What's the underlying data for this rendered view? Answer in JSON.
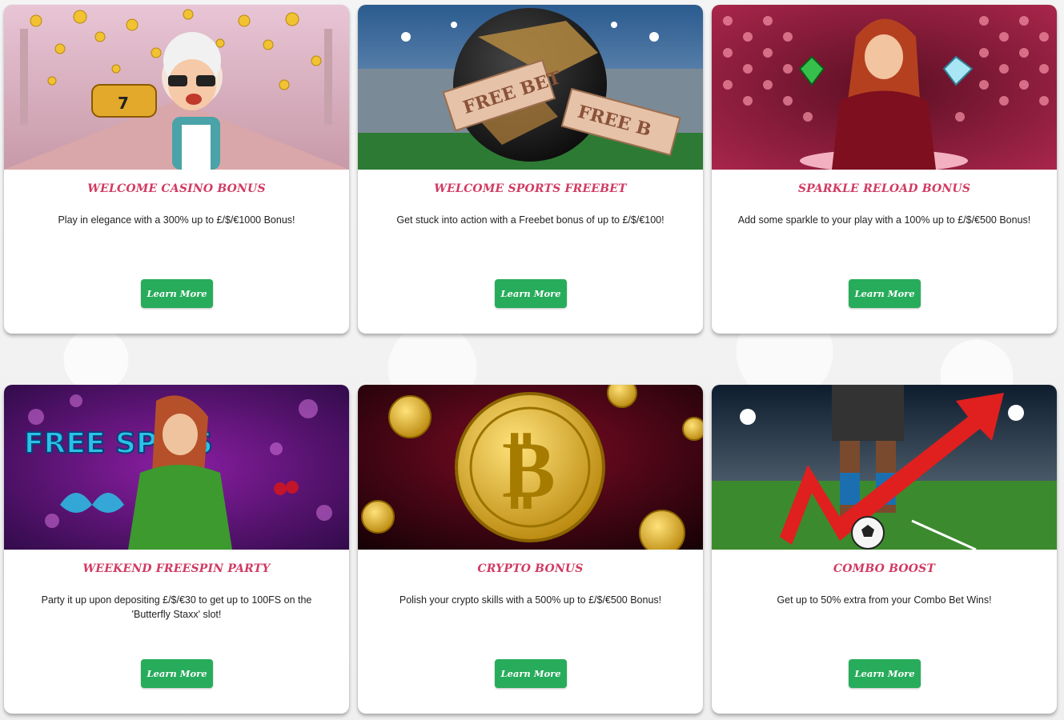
{
  "promotions": [
    {
      "title": "WELCOME CASINO BONUS",
      "description": "Play in elegance with a 300% up to £/$/€1000 Bonus!",
      "button_label": "Learn More",
      "banner_icon": "granny-slot-illustration",
      "banner_colors": [
        "#e7c6d6",
        "#f3dfe8",
        "#f2c12e"
      ]
    },
    {
      "title": "WELCOME SPORTS FREEBET",
      "description": "Get stuck into action with a Freebet bonus of up to £/$/€100!",
      "button_label": "Learn More",
      "banner_icon": "football-freebet-illustration",
      "banner_text": "FREE BET",
      "banner_colors": [
        "#1f4d7f",
        "#2d7a34",
        "#b58a42"
      ]
    },
    {
      "title": "SPARKLE RELOAD BONUS",
      "description": "Add some sparkle to your play with a 100% up to £/$/€500 Bonus!",
      "button_label": "Learn More",
      "banner_icon": "sorceress-gems-illustration",
      "banner_colors": [
        "#5c0f24",
        "#d1476b",
        "#f08aa2"
      ]
    },
    {
      "title": "WEEKEND FREESPIN PARTY",
      "description": "Party it up upon depositing £/$/€30 to get up to 100FS on the 'Butterfly Staxx' slot!",
      "button_label": "Learn More",
      "banner_icon": "freespins-illustration",
      "banner_text": "FREE SPINS",
      "banner_colors": [
        "#35104d",
        "#8b1ea3",
        "#2bc1e8"
      ]
    },
    {
      "title": "CRYPTO BONUS",
      "description": "Polish your crypto skills with a 500% up to £/$/€500 Bonus!",
      "button_label": "Learn More",
      "banner_icon": "bitcoin-coin-illustration",
      "banner_colors": [
        "#1a0208",
        "#7d0b24",
        "#e7b93a"
      ]
    },
    {
      "title": "COMBO BOOST",
      "description": "Get up to 50% extra from your Combo Bet Wins!",
      "button_label": "Learn More",
      "banner_icon": "football-arrow-illustration",
      "banner_colors": [
        "#0e1d2e",
        "#3c8a2e",
        "#e01f1f"
      ]
    }
  ],
  "theme": {
    "title_color": "#d13b63",
    "button_color": "#27ac5b",
    "page_background": "#f3f3f3"
  }
}
